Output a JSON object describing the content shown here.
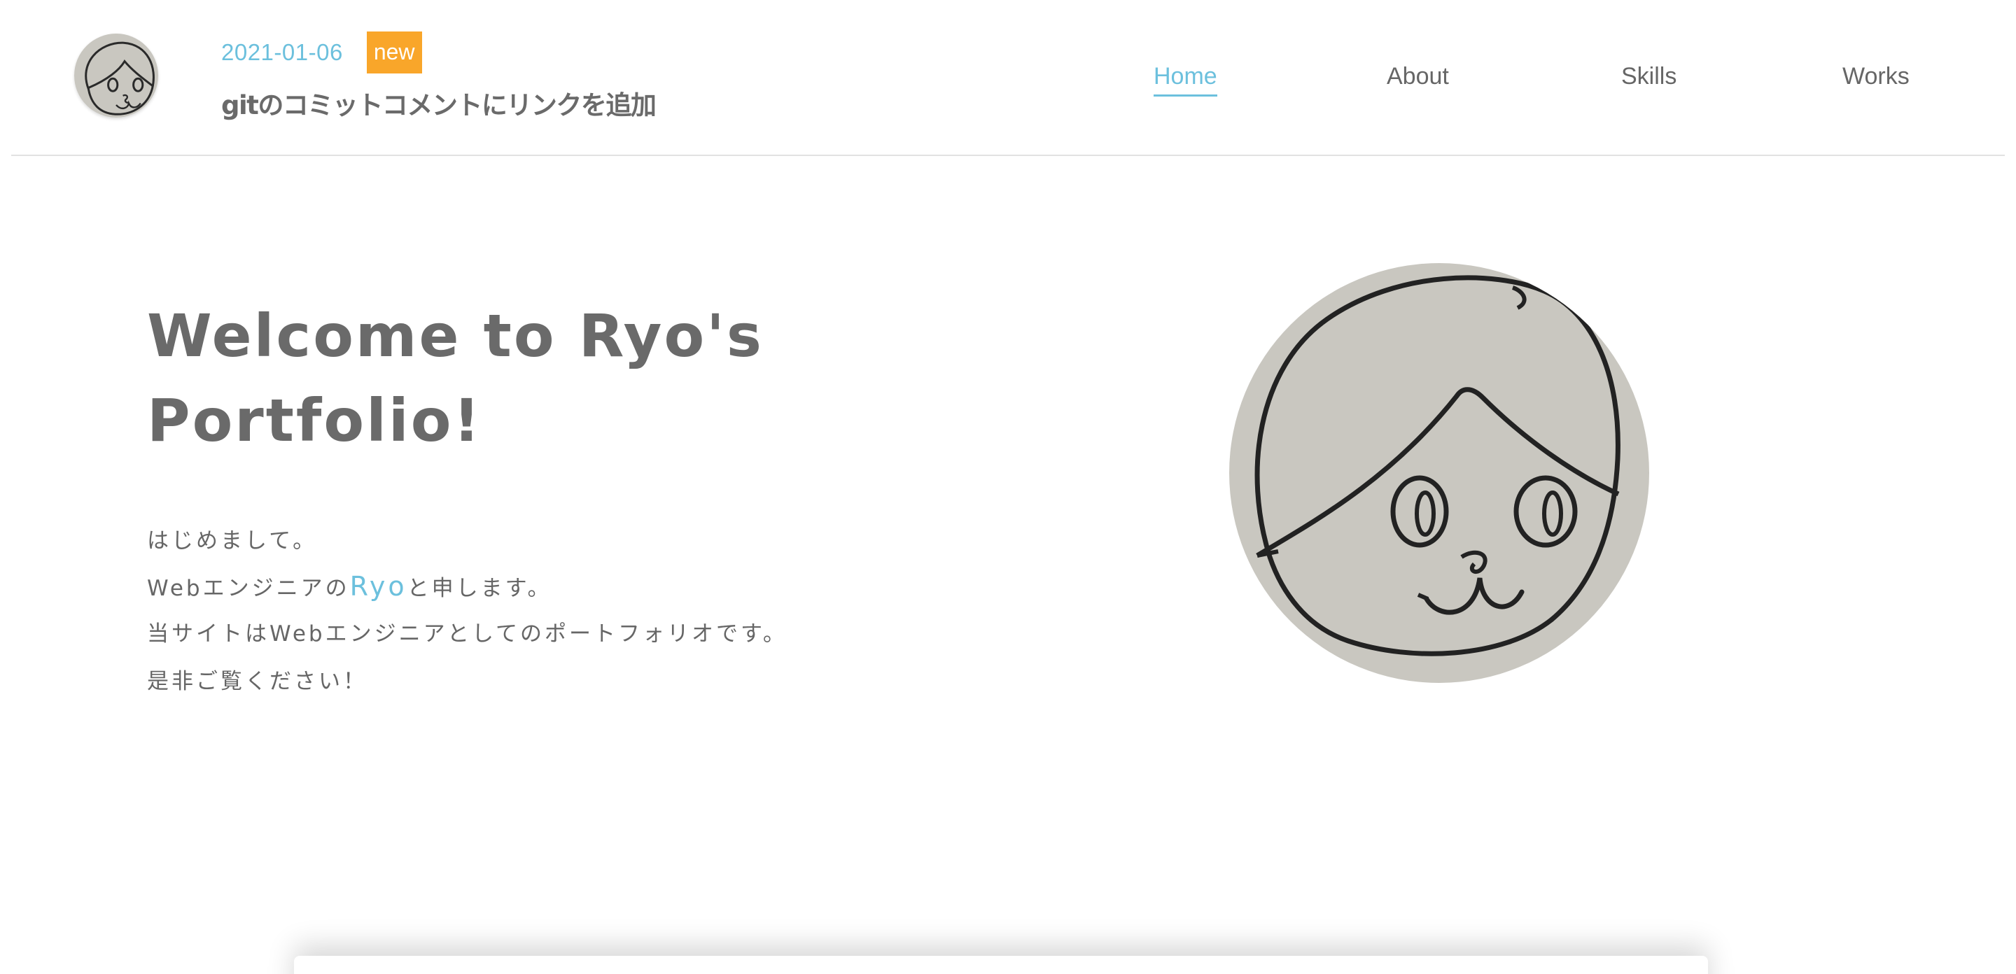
{
  "header": {
    "news": {
      "date": "2021-01-06",
      "badge": "new",
      "title": "gitのコミットコメントにリンクを追加"
    },
    "nav": [
      {
        "label": "Home",
        "active": true
      },
      {
        "label": "About",
        "active": false
      },
      {
        "label": "Skills",
        "active": false
      },
      {
        "label": "Works",
        "active": false
      }
    ],
    "logo_icon": "face-drawing-icon"
  },
  "hero": {
    "title_line1": "Welcome to Ryo's",
    "title_line2": "Portfolio!",
    "line1": "はじめまして。",
    "line2_prefix": "Webエンジニアの",
    "line2_name": "Ryo",
    "line2_suffix": "と申します。",
    "line3": "当サイトはWebエンジニアとしてのポートフォリオです。",
    "line4": "是非ご覧ください！",
    "avatar_icon": "face-drawing-icon"
  },
  "colors": {
    "accent": "#6cc0dd",
    "badge": "#f9a62a",
    "text": "#666666",
    "avatar_bg": "#c9c7c0"
  }
}
